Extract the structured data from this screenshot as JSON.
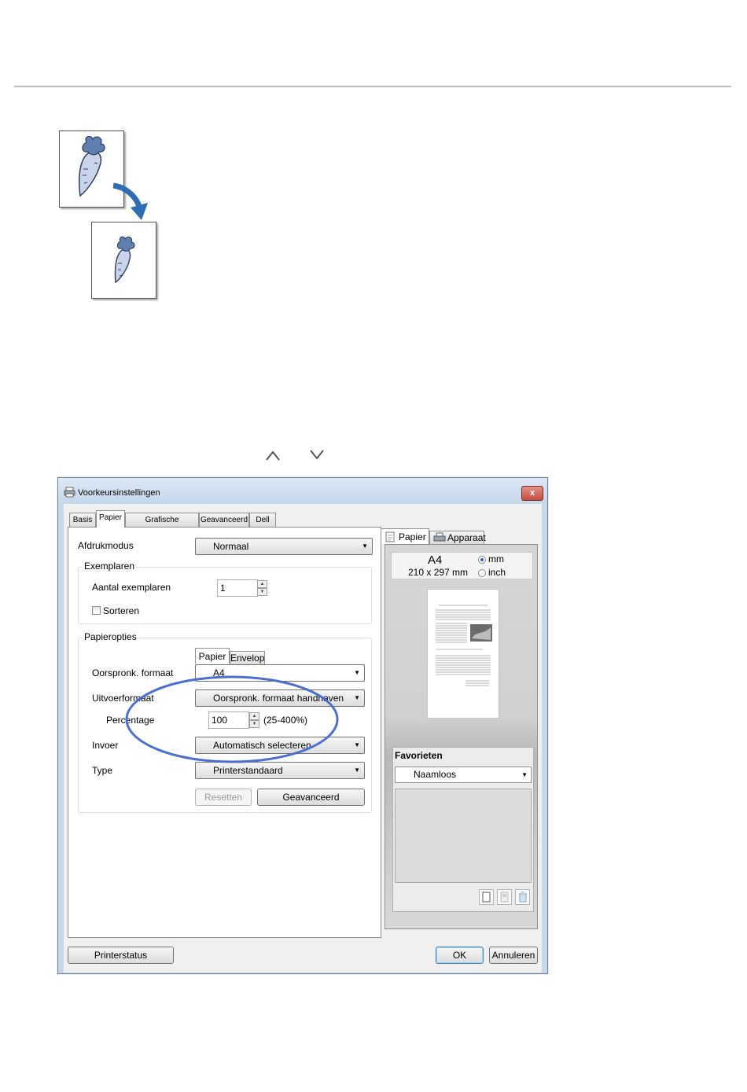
{
  "dialog": {
    "title": "Voorkeursinstellingen",
    "close_label": "x",
    "tabs": [
      "Basis",
      "Papier",
      "Grafische elementen",
      "Geavanceerd",
      "Dell"
    ],
    "printmode": {
      "label": "Afdrukmodus",
      "value": "Normaal"
    },
    "copies": {
      "group": "Exemplaren",
      "label": "Aantal exemplaren",
      "value": "1",
      "collate": "Sorteren"
    },
    "paper_options": {
      "group": "Papieropties",
      "subtabs": [
        "Papier",
        "Envelop"
      ],
      "original_size": {
        "label": "Oorspronk. formaat",
        "value": "A4"
      },
      "output_size": {
        "label": "Uitvoerformaat",
        "value": "Oorspronk. formaat handhaven"
      },
      "percentage": {
        "label": "Percentage",
        "value": "100",
        "range": "(25-400%)"
      },
      "source": {
        "label": "Invoer",
        "value": "Automatisch selecteren"
      },
      "type": {
        "label": "Type",
        "value": "Printerstandaard"
      },
      "reset_label": "Resetten",
      "advanced_label": "Geavanceerd"
    },
    "preview": {
      "tabs": [
        "Papier",
        "Apparaat"
      ],
      "size_name": "A4",
      "size_dims": "210 x 297 mm",
      "units": [
        "mm",
        "inch"
      ]
    },
    "favorites": {
      "title": "Favorieten",
      "selected": "Naamloos"
    },
    "footer": {
      "status_label": "Printerstatus",
      "ok_label": "OK",
      "cancel_label": "Annuleren"
    }
  },
  "colors": {
    "highlight_ellipse": "#4a6fd0",
    "arrow": "#2e6db3",
    "window_frame": "#c5d7ea"
  }
}
